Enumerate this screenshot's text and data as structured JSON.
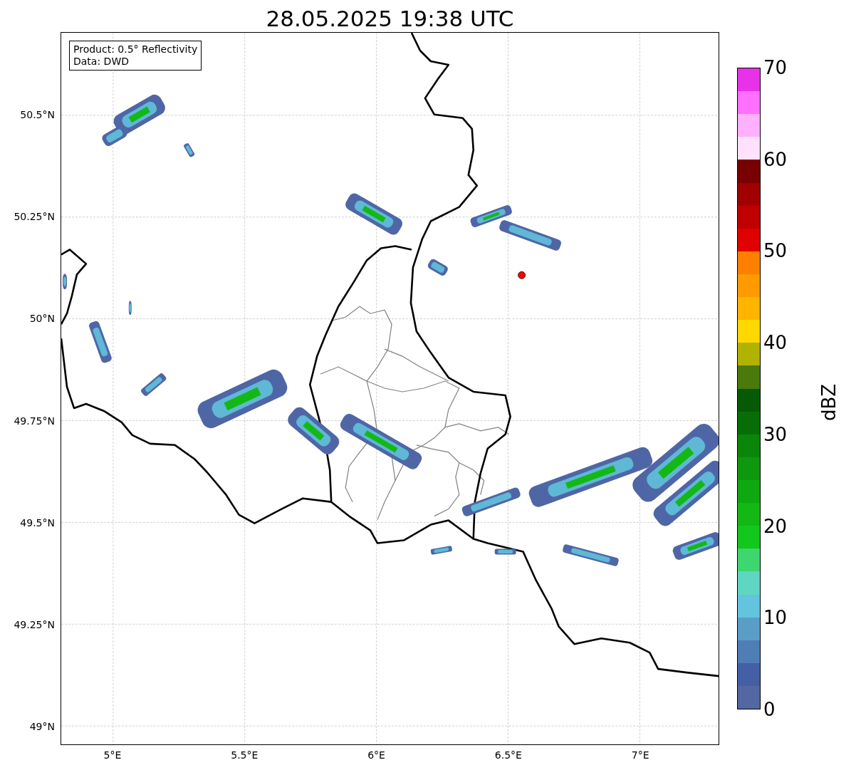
{
  "title": "28.05.2025 19:38 UTC",
  "info_box": {
    "lines": [
      "Product: 0.5° Reflectivity",
      "Data: DWD"
    ]
  },
  "y_ticks": [
    "50.5°N",
    "50.25°N",
    "50°N",
    "49.75°N",
    "49.5°N",
    "49.25°N",
    "49°N"
  ],
  "x_ticks": [
    "5°E",
    "5.5°E",
    "6°E",
    "6.5°E",
    "7°E"
  ],
  "colorbar": {
    "label": "dBZ",
    "ticks": [
      "70",
      "60",
      "50",
      "40",
      "30",
      "20",
      "10",
      "0"
    ]
  }
}
